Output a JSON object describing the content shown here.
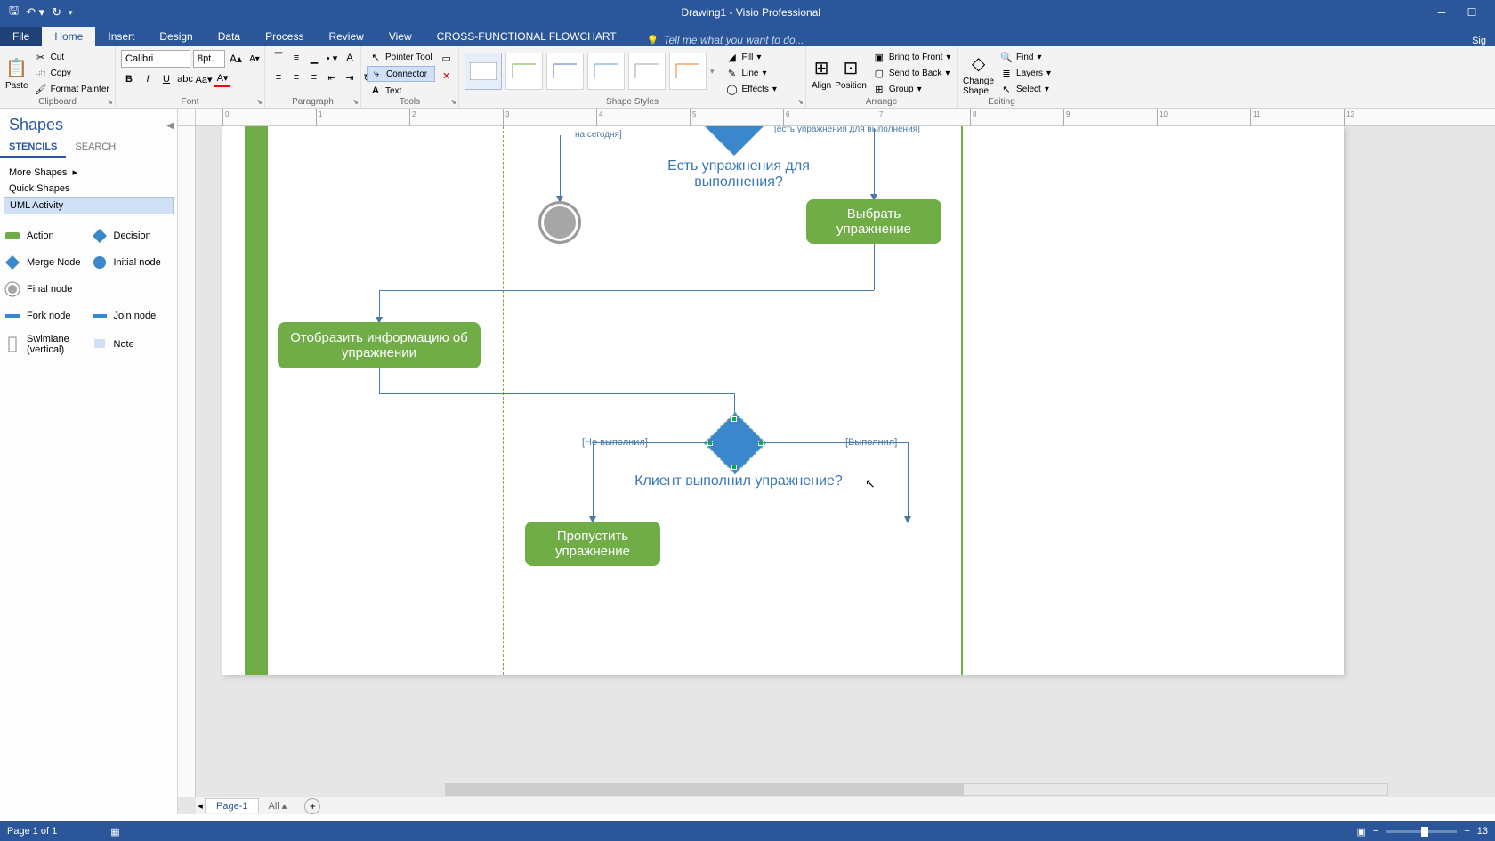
{
  "titlebar": {
    "title": "Drawing1 - Visio Professional"
  },
  "tabs": {
    "file": "File",
    "home": "Home",
    "insert": "Insert",
    "design": "Design",
    "data": "Data",
    "process": "Process",
    "review": "Review",
    "view": "View",
    "flowchart": "CROSS-FUNCTIONAL FLOWCHART",
    "tellme": "Tell me what you want to do...",
    "signin": "Sig"
  },
  "ribbon": {
    "clipboard": {
      "label": "Clipboard",
      "paste": "Paste",
      "cut": "Cut",
      "copy": "Copy",
      "fmt": "Format Painter"
    },
    "font": {
      "label": "Font",
      "family": "Calibri",
      "size": "8pt."
    },
    "paragraph": {
      "label": "Paragraph"
    },
    "tools": {
      "label": "Tools",
      "pointer": "Pointer Tool",
      "connector": "Connector",
      "text": "Text"
    },
    "shapestyles": {
      "label": "Shape Styles",
      "fill": "Fill",
      "line": "Line",
      "effects": "Effects"
    },
    "arrange": {
      "label": "Arrange",
      "align": "Align",
      "position": "Position",
      "front": "Bring to Front",
      "back": "Send to Back",
      "group": "Group"
    },
    "editing": {
      "label": "Editing",
      "change": "Change Shape",
      "find": "Find",
      "layers": "Layers",
      "select": "Select"
    }
  },
  "shapes_panel": {
    "title": "Shapes",
    "tab_stencils": "STENCILS",
    "tab_search": "SEARCH",
    "more": "More Shapes",
    "quick": "Quick Shapes",
    "uml": "UML Activity",
    "items": {
      "action": "Action",
      "decision": "Decision",
      "merge": "Merge Node",
      "initial": "Initial node",
      "final": "Final node",
      "fork": "Fork node",
      "join": "Join node",
      "swimlane": "Swimlane (vertical)",
      "note": "Note"
    }
  },
  "diagram": {
    "top_label_left": "на сегодня]",
    "top_label_right": "[есть упражнения для выполнения]",
    "q1": "Есть упражнения для выполнения?",
    "action_select": "Выбрать упражнение",
    "action_info": "Отобразить информацию об упражнении",
    "branch_no": "[Не выполнил]",
    "branch_yes": "[Выполнил]",
    "q2": "Клиент выполнил упражнение?",
    "action_skip": "Пропустить упражнение"
  },
  "pagetabs": {
    "page1": "Page-1",
    "all": "All"
  },
  "status": {
    "page": "Page 1 of 1",
    "zoom": "13"
  }
}
